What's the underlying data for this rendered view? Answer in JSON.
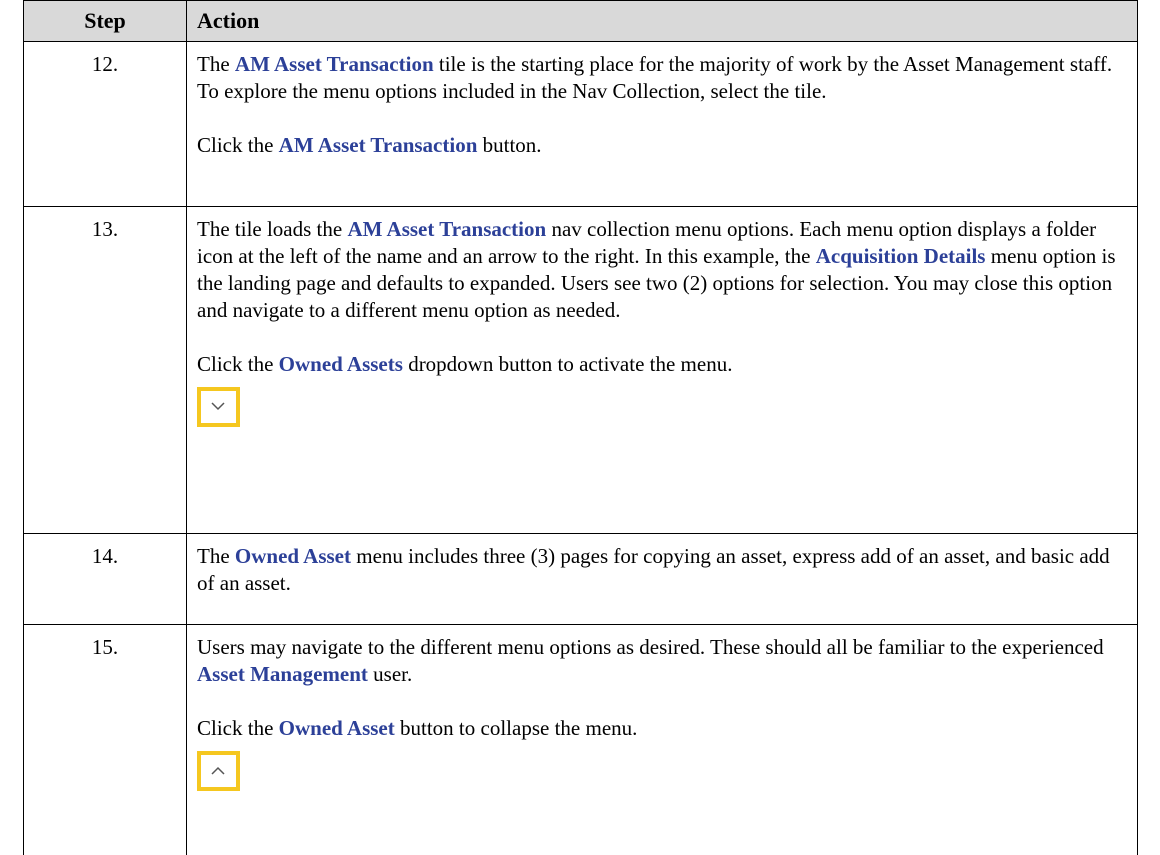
{
  "header": {
    "step": "Step",
    "action": "Action"
  },
  "rows": [
    {
      "num": "12.",
      "p1": [
        "The ",
        "AM Asset Transaction",
        " tile is the starting place for the majority of work by the Asset Management staff. To explore the menu options included in the Nav Collection, select the tile."
      ],
      "p2": [
        "Click the ",
        "AM Asset Transaction",
        " button."
      ]
    },
    {
      "num": "13.",
      "p1": [
        "The tile loads the ",
        "AM Asset Transaction",
        " nav collection menu options. Each menu option displays a folder icon at the left of the name and an arrow to the right. In this example, the ",
        "Acquisition Details",
        " menu option is the landing page and defaults to expanded. Users see two (2) options for selection. You may close this option and navigate to a different menu option as needed."
      ],
      "p2": [
        "Click the ",
        "Owned Assets",
        " dropdown button to activate the menu."
      ],
      "icon": "chevron-down-icon"
    },
    {
      "num": "14.",
      "p1": [
        "The ",
        "Owned Asset",
        " menu includes three (3) pages for copying an asset, express add of an asset, and basic add of an asset."
      ]
    },
    {
      "num": "15.",
      "p1": [
        "Users may navigate to the different menu options as desired. These should all be familiar to the experienced ",
        "Asset Management",
        " user."
      ],
      "p2": [
        "Click the ",
        "Owned Asset",
        " button to collapse the menu."
      ],
      "icon": "chevron-up-icon"
    }
  ],
  "colors": {
    "highlight": "#2c4098",
    "icon_border": "#f5c71f",
    "header_bg": "#d9d9d9"
  }
}
